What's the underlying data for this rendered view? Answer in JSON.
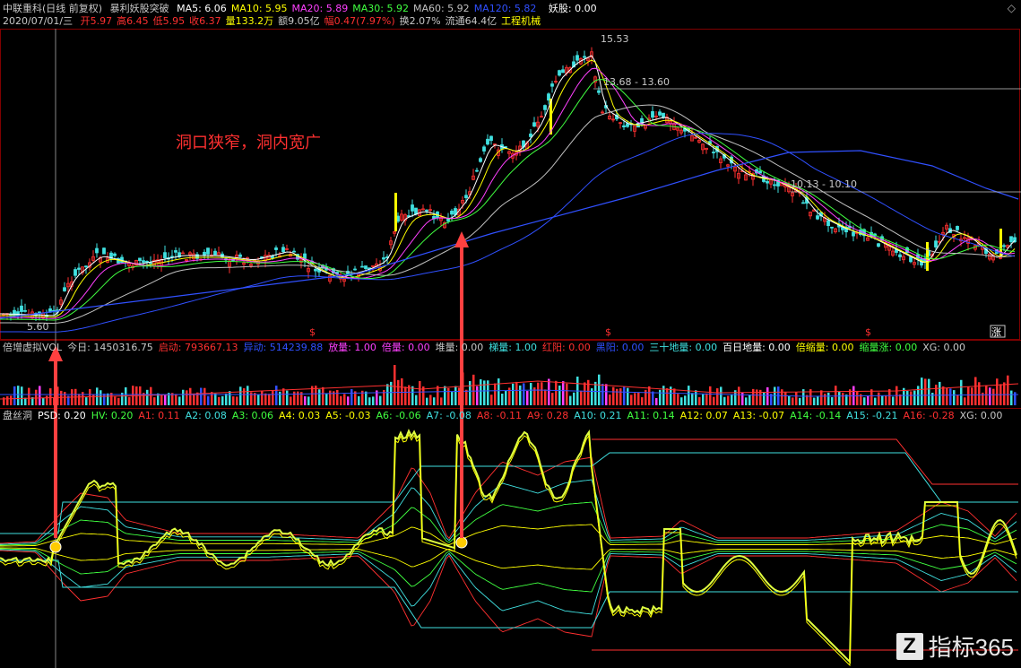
{
  "header": {
    "stock": "中联重科(日线 前复权)",
    "indicator": "暴利妖股突破",
    "ma": [
      {
        "label": "MA5: 6.06",
        "color": "#ffffff"
      },
      {
        "label": "MA10: 5.95",
        "color": "#ffff00"
      },
      {
        "label": "MA20: 5.89",
        "color": "#ff40ff"
      },
      {
        "label": "MA30: 5.92",
        "color": "#40ff40"
      },
      {
        "label": "MA60: 5.92",
        "color": "#c0c0c0"
      },
      {
        "label": "MA120: 5.82",
        "color": "#3050ff"
      }
    ],
    "yaogu": "妖股: 0.00",
    "date": "2020/07/01/三",
    "quote": [
      {
        "label": "开5.97",
        "color": "#ff3030"
      },
      {
        "label": "高6.45",
        "color": "#ff3030"
      },
      {
        "label": "低5.95",
        "color": "#ff3030"
      },
      {
        "label": "收6.37",
        "color": "#ff3030"
      },
      {
        "label": "量133.2万",
        "color": "#ffff00"
      },
      {
        "label": "额9.05亿",
        "color": "#c8c8c8"
      },
      {
        "label": "幅0.47(7.97%)",
        "color": "#ff3030"
      },
      {
        "label": "换2.07%",
        "color": "#c8c8c8"
      },
      {
        "label": "流通64.4亿",
        "color": "#c8c8c8"
      },
      {
        "label": "工程机械",
        "color": "#ffff00"
      }
    ]
  },
  "price_chart": {
    "annotation": "洞口狭窄，洞内宽广",
    "high_label": "15.53",
    "low_label": "5.60",
    "level1": "13.68 - 13.60",
    "level2": "10.13 - 10.10",
    "s_marks": [
      "$",
      "$",
      "$"
    ],
    "zhang": "涨",
    "colors": {
      "up": "#ff3030",
      "down": "#40e0e0",
      "signal": "#ffff00"
    }
  },
  "vol_panel": {
    "items": [
      {
        "label": "倍增虚拟VOL",
        "color": "#c8c8c8"
      },
      {
        "label": "今日: 1450316.75",
        "color": "#c8c8c8"
      },
      {
        "label": "启动: 793667.13",
        "color": "#ff3030"
      },
      {
        "label": "异动: 514239.88",
        "color": "#3050ff"
      },
      {
        "label": "放量: 1.00",
        "color": "#ff40ff"
      },
      {
        "label": "倍量: 0.00",
        "color": "#ff40ff"
      },
      {
        "label": "堆量: 0.00",
        "color": "#c8c8c8"
      },
      {
        "label": "梯量: 1.00",
        "color": "#40e0e0"
      },
      {
        "label": "红阳: 0.00",
        "color": "#ff3030"
      },
      {
        "label": "黑阳: 0.00",
        "color": "#3050ff"
      },
      {
        "label": "三十地量: 0.00",
        "color": "#40e0e0"
      },
      {
        "label": "百日地量: 0.00",
        "color": "#ffffff"
      },
      {
        "label": "倍缩量: 0.00",
        "color": "#ffff00"
      },
      {
        "label": "缩量涨: 0.00",
        "color": "#40ff40"
      },
      {
        "label": "XG: 0.00",
        "color": "#c8c8c8"
      }
    ]
  },
  "psd_panel": {
    "items": [
      {
        "label": "盘丝洞",
        "color": "#c8c8c8"
      },
      {
        "label": "PSD: 0.20",
        "color": "#ffffff"
      },
      {
        "label": "HV: 0.20",
        "color": "#40ff40"
      },
      {
        "label": "A1: 0.11",
        "color": "#ff3030"
      },
      {
        "label": "A2: 0.08",
        "color": "#40e0e0"
      },
      {
        "label": "A3: 0.06",
        "color": "#40ff40"
      },
      {
        "label": "A4: 0.03",
        "color": "#ffff00"
      },
      {
        "label": "A5: -0.03",
        "color": "#ffff00"
      },
      {
        "label": "A6: -0.06",
        "color": "#40ff40"
      },
      {
        "label": "A7: -0.08",
        "color": "#40e0e0"
      },
      {
        "label": "A8: -0.11",
        "color": "#ff3030"
      },
      {
        "label": "A9: 0.28",
        "color": "#ff3030"
      },
      {
        "label": "A10: 0.21",
        "color": "#40e0e0"
      },
      {
        "label": "A11: 0.14",
        "color": "#40ff40"
      },
      {
        "label": "A12: 0.07",
        "color": "#ffff00"
      },
      {
        "label": "A13: -0.07",
        "color": "#ffff00"
      },
      {
        "label": "A14: -0.14",
        "color": "#40ff40"
      },
      {
        "label": "A15: -0.21",
        "color": "#40e0e0"
      },
      {
        "label": "A16: -0.28",
        "color": "#ff3030"
      },
      {
        "label": "XG: 0.00",
        "color": "#c8c8c8"
      }
    ]
  },
  "watermark": {
    "logo": "Z",
    "text": "指标365"
  },
  "window": {
    "collapse_icon": "collapse-up-icon"
  }
}
